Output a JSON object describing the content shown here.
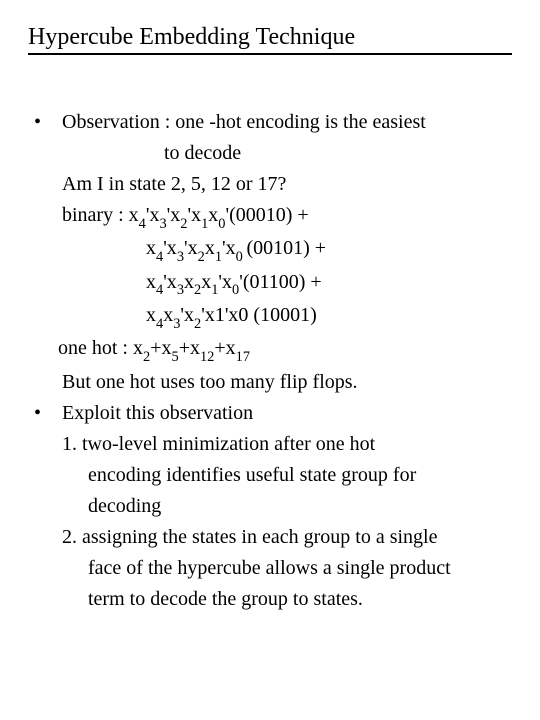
{
  "title": "Hypercube Embedding Technique",
  "b1": "Observation : one -hot encoding is the easiest",
  "b1_cont": "to decode",
  "l_am": "Am I in state 2, 5, 12 or 17?",
  "bin_label": "binary : ",
  "bin1_a": "x",
  "bin1_s1": "4",
  "bin1_b": "'x",
  "bin1_s2": "3",
  "bin1_c": "'x",
  "bin1_s3": "2",
  "bin1_d": "'x",
  "bin1_s4": "1",
  "bin1_e": "x",
  "bin1_s5": "0",
  "bin1_f": "'(00010) +",
  "bin2_a": "x",
  "bin2_s1": "4",
  "bin2_b": "'x",
  "bin2_s2": "3",
  "bin2_c": "'x",
  "bin2_s3": "2",
  "bin2_d": "x",
  "bin2_s4": "1",
  "bin2_e": "'x",
  "bin2_s5": "0 ",
  "bin2_f": "(00101) +",
  "bin3_a": "x",
  "bin3_s1": "4",
  "bin3_b": "'x",
  "bin3_s2": "3",
  "bin3_c": "x",
  "bin3_s3": "2",
  "bin3_d": "x",
  "bin3_s4": "1",
  "bin3_e": "'x",
  "bin3_s5": "0",
  "bin3_f": "'(01100) +",
  "bin4_a": "x",
  "bin4_s1": "4",
  "bin4_b": "x",
  "bin4_s2": "3",
  "bin4_c": "'x",
  "bin4_s3": "2",
  "bin4_d": "'x1'x0 (10001)",
  "oh_label": "one hot : ",
  "oh_a": "x",
  "oh_s1": "2",
  "oh_b": "+x",
  "oh_s2": "5",
  "oh_c": "+x",
  "oh_s3": "12",
  "oh_d": "+x",
  "oh_s4": "17",
  "l_but": "But one hot uses too many flip flops.",
  "b2": "Exploit this observation",
  "n1": "1. two-level minimization after one hot",
  "n1b": "encoding identifies useful state group for",
  "n1c": "decoding",
  "n2": "2. assigning the states in each group to a single",
  "n2b": "face of the hypercube allows a single product",
  "n2c": "term to decode the group to states."
}
